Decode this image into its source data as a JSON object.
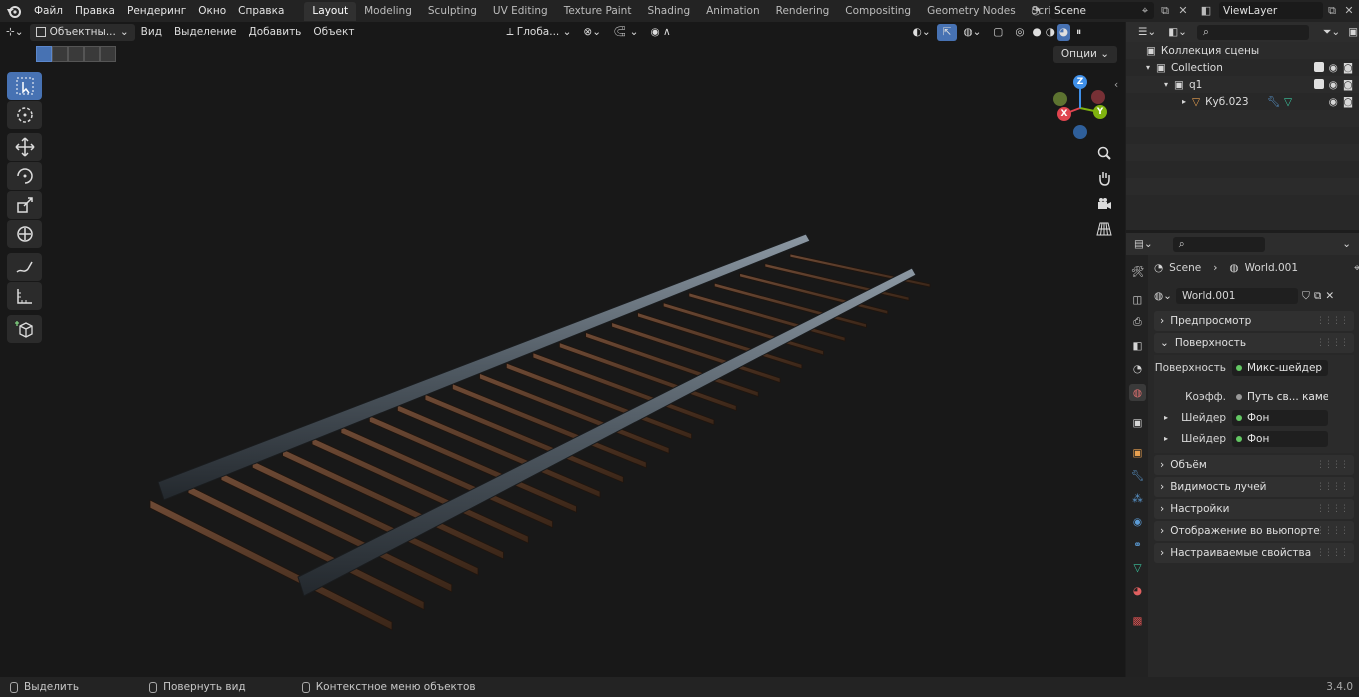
{
  "topbar": {
    "menus": [
      "Файл",
      "Правка",
      "Рендеринг",
      "Окно",
      "Справка"
    ],
    "workspaces": [
      "Layout",
      "Modeling",
      "Sculpting",
      "UV Editing",
      "Texture Paint",
      "Shading",
      "Animation",
      "Rendering",
      "Compositing",
      "Geometry Nodes",
      "Scripting"
    ],
    "active_workspace": "Layout",
    "scene": "Scene",
    "view_layer": "ViewLayer"
  },
  "viewport": {
    "mode": "Объектны...",
    "menus": [
      "Вид",
      "Выделение",
      "Добавить",
      "Объект"
    ],
    "transform_orientation": "Глоба...",
    "options_label": "Опции"
  },
  "gizmo": {
    "x": "X",
    "y": "Y",
    "z": "Z"
  },
  "outliner": {
    "rows": [
      {
        "label": "Коллекция сцены",
        "indent": 0
      },
      {
        "label": "Collection",
        "indent": 1
      },
      {
        "label": "q1",
        "indent": 2
      },
      {
        "label": "Куб.023",
        "indent": 3
      }
    ]
  },
  "properties": {
    "breadcrumb_scene": "Scene",
    "breadcrumb_world": "World.001",
    "world_name": "World.001",
    "panels": {
      "preview": "Предпросмотр",
      "surface": "Поверхность",
      "volume": "Объём",
      "ray_visibility": "Видимость лучей",
      "settings": "Настройки",
      "viewport_display": "Отображение во вьюпорте",
      "custom_props": "Настраиваемые свойства"
    },
    "surface_rows": [
      {
        "label": "Поверхность",
        "value": "Микс-шейдер"
      },
      {
        "label": "Коэфф.",
        "value": "Путь св... камеры"
      },
      {
        "label": "Шейдер",
        "value": "Фон"
      },
      {
        "label": "Шейдер",
        "value": "Фон"
      }
    ]
  },
  "statusbar": {
    "items": [
      "Выделить",
      "Повернуть вид",
      "Контекстное меню объектов"
    ],
    "version": "3.4.0"
  },
  "colors": {
    "accent": "#4772b3",
    "gizmo_x": "#e0444f",
    "gizmo_y": "#7fb20f",
    "gizmo_z": "#3f8fe8",
    "node_socket": "#63c763"
  }
}
